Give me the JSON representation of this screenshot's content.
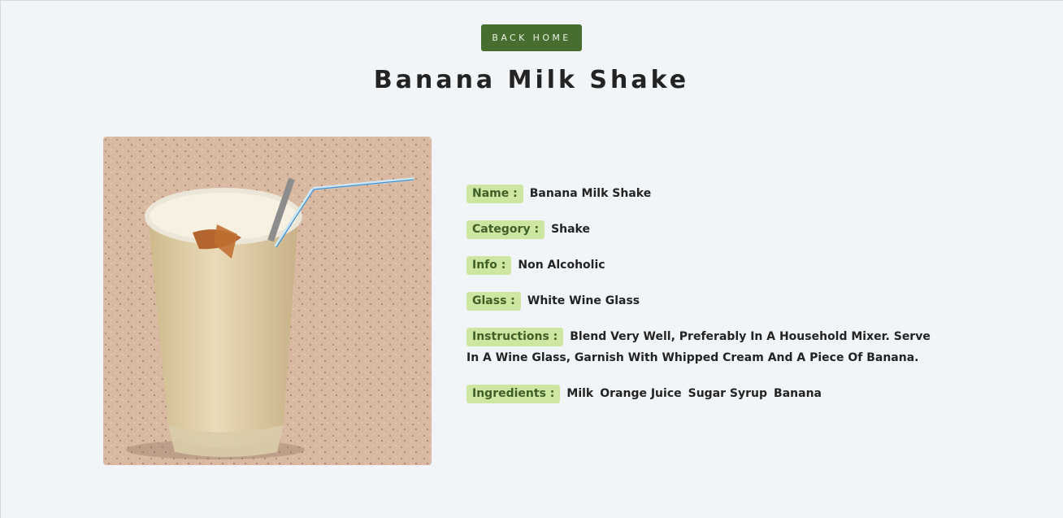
{
  "header": {
    "back_button": "back home",
    "title": "Banana Milk Shake"
  },
  "image": {
    "alt": "Banana Milk Shake"
  },
  "details": {
    "name_label": "Name :",
    "name": "Banana Milk Shake",
    "category_label": "Category :",
    "category": "Shake",
    "info_label": "Info :",
    "info": "Non Alcoholic",
    "glass_label": "Glass :",
    "glass": "White Wine Glass",
    "instructions_label": "Instructions :",
    "instructions": "Blend Very Well, Preferably In A Household Mixer. Serve In A Wine Glass, Garnish With Whipped Cream And A Piece Of Banana.",
    "ingredients_label": "Ingredients :",
    "ingredients": [
      "Milk",
      "Orange Juice",
      "Sugar Syrup",
      "Banana"
    ]
  },
  "colors": {
    "background": "#f1f5f8",
    "button": "#476e2f",
    "label_bg": "#cde6a1",
    "label_text": "#3f5f28"
  }
}
